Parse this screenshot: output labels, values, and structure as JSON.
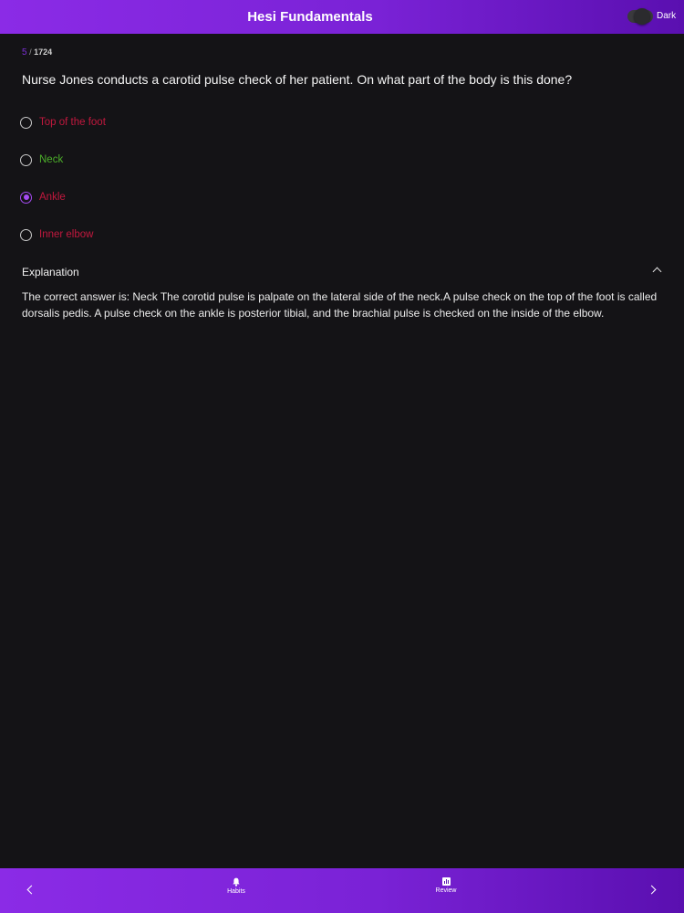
{
  "header": {
    "title": "Hesi Fundamentals",
    "theme_toggle_label": "Dark"
  },
  "counter": {
    "current": "5",
    "separator": "/",
    "total": "1724"
  },
  "question": {
    "text": "Nurse Jones conducts a carotid pulse check of her patient. On what part of the body is this done?"
  },
  "options": [
    {
      "label": "Top of the foot",
      "color": "#c2183e",
      "selected": false
    },
    {
      "label": "Neck",
      "color": "#4caf2a",
      "selected": false
    },
    {
      "label": "Ankle",
      "color": "#c2183e",
      "selected": true
    },
    {
      "label": "Inner elbow",
      "color": "#c2183e",
      "selected": false
    }
  ],
  "explanation": {
    "title": "Explanation",
    "text": "The correct answer is: Neck The corotid pulse is palpate on the lateral side of the neck.A pulse check on the top of the foot is called dorsalis pedis. A pulse check on the ankle is posterior tibial, and the brachial pulse is checked on the inside of the elbow."
  },
  "bottom_nav": {
    "habits_label": "Habits",
    "review_label": "Review"
  },
  "colors": {
    "accent": "#8b2be6",
    "selected_radio": "#a64bf4",
    "background": "#141316"
  }
}
